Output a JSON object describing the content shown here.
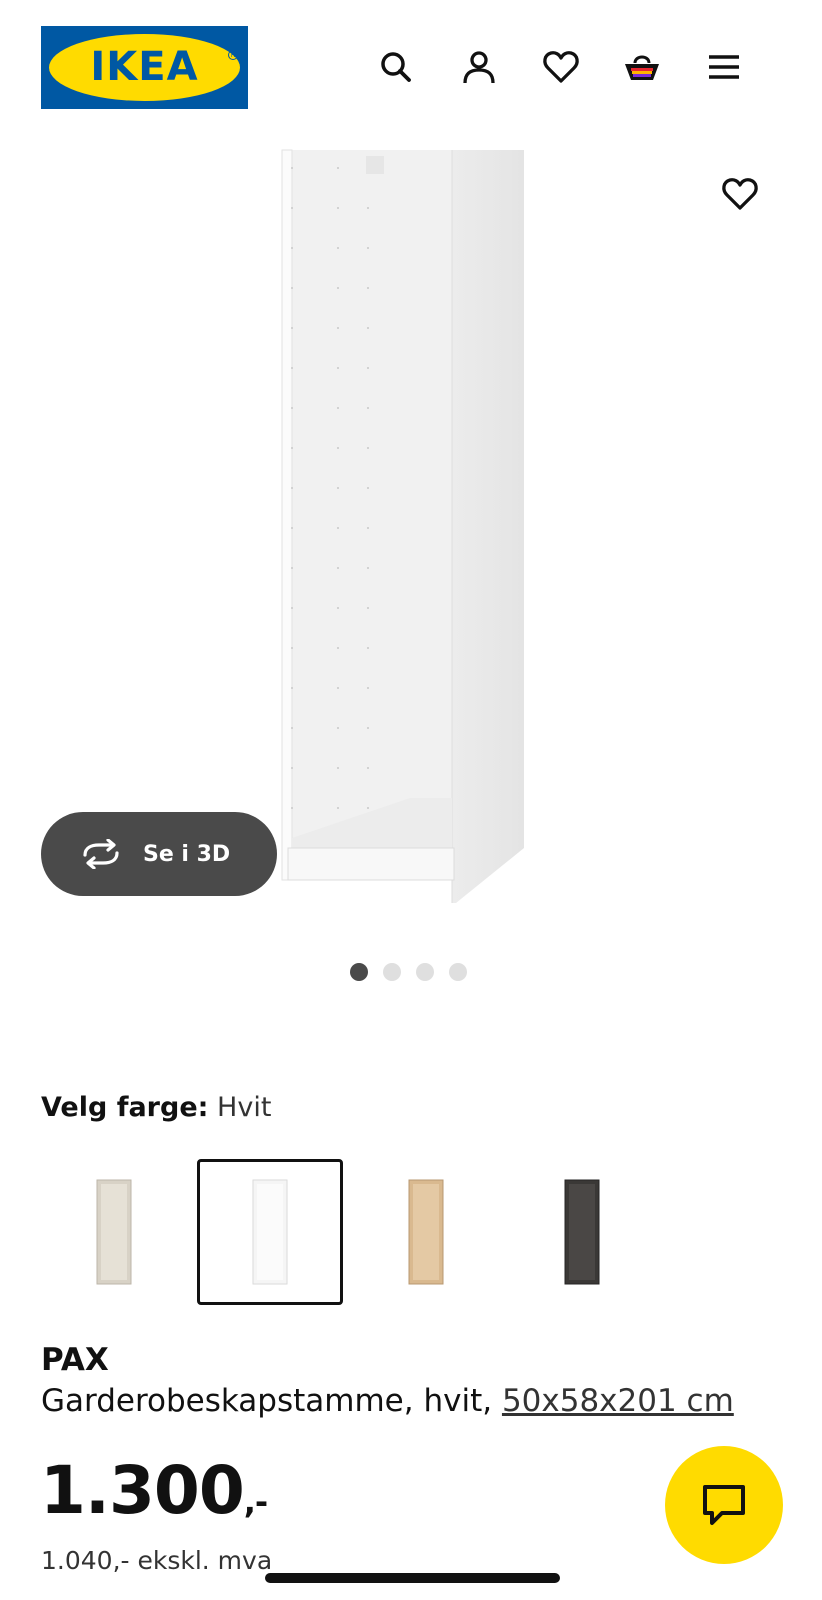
{
  "header": {
    "logo_text": "IKEA",
    "icons": [
      "search-icon",
      "account-icon",
      "favorites-icon",
      "cart-icon",
      "menu-icon"
    ]
  },
  "hero": {
    "image_alt": "PAX wardrobe frame",
    "view_3d_label": "Se i 3D",
    "carousel": {
      "total": 4,
      "active": 1
    }
  },
  "color": {
    "label": "Velg farge:",
    "selected": "Hvit",
    "swatches": [
      {
        "name": "beige",
        "color": "#d8d2c6"
      },
      {
        "name": "hvit",
        "color": "#f5f5f5"
      },
      {
        "name": "eik",
        "color": "#d9b98f"
      },
      {
        "name": "svartbrun",
        "color": "#3a3836"
      }
    ]
  },
  "product": {
    "name": "PAX",
    "description": "Garderobeskapstamme, hvit, ",
    "dimensions": "50x58x201 cm",
    "price": "1.300",
    "price_suffix": ",-",
    "price_ex_vat": "1.040,- ekskl. mva"
  },
  "colors": {
    "ikea_blue": "#0058a3",
    "ikea_yellow": "#ffdb00",
    "dark_button": "#4a4a4a"
  }
}
